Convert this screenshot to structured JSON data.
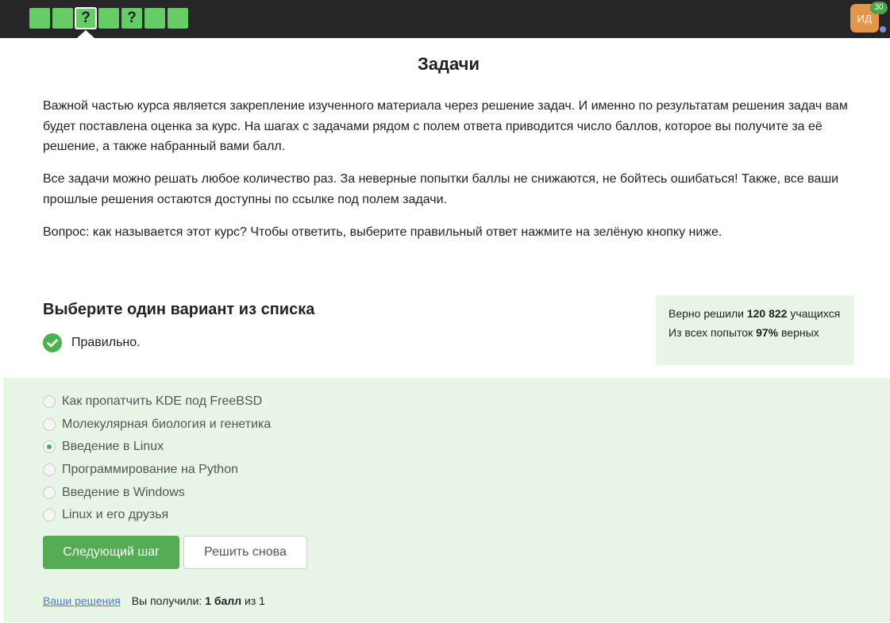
{
  "topbar": {
    "steps": [
      {
        "label": "",
        "state": "done"
      },
      {
        "label": "",
        "state": "done"
      },
      {
        "label": "?",
        "state": "active"
      },
      {
        "label": "",
        "state": "done"
      },
      {
        "label": "?",
        "state": "done"
      },
      {
        "label": "",
        "state": "done"
      },
      {
        "label": "",
        "state": "done"
      }
    ],
    "avatar_initials": "ИД",
    "notification_count": "30"
  },
  "page": {
    "title": "Задачи",
    "paragraphs": [
      "Важной частью курса является закрепление изученного материала через решение задач. И именно по результатам решения задач вам будет поставлена оценка за курс. На шагах с задачами рядом с полем ответа приводится число баллов, которое вы получите за её решение, а также набранный вами балл.",
      "Все задачи можно решать любое количество раз. За неверные попытки баллы не снижаются, не бойтесь ошибаться! Также, все ваши прошлые решения остаются доступны по ссылке под полем задачи.",
      "Вопрос: как называется этот курс? Чтобы ответить, выберите правильный ответ нажмите на зелёную кнопку ниже."
    ]
  },
  "quiz": {
    "heading": "Выберите один вариант из списка",
    "result": "Правильно.",
    "options": [
      {
        "label": "Как пропатчить KDE под FreeBSD",
        "checked": false
      },
      {
        "label": "Молекулярная биология и генетика",
        "checked": false
      },
      {
        "label": "Введение в Linux",
        "checked": true
      },
      {
        "label": "Программирование на Python",
        "checked": false
      },
      {
        "label": "Введение в Windows",
        "checked": false
      },
      {
        "label": "Linux и его друзья",
        "checked": false
      }
    ],
    "next_button": "Следующий шаг",
    "retry_button": "Решить снова"
  },
  "stats": {
    "solved_prefix": "Верно решили",
    "solved_count": "120 822",
    "solved_suffix": "учащихся",
    "attempts_prefix": "Из всех попыток",
    "attempts_percent": "97%",
    "attempts_suffix": "верных"
  },
  "footer": {
    "solutions_link": "Ваши решения",
    "score_prefix": "Вы получили:",
    "score_value": "1 балл",
    "score_suffix": "из 1"
  },
  "colors": {
    "topbar": "#262626",
    "step_green": "#66cc66",
    "accent_green": "#54ad54",
    "panel_bg": "#e7f6e7",
    "avatar": "#e5954a",
    "link": "#4d7cc7"
  }
}
